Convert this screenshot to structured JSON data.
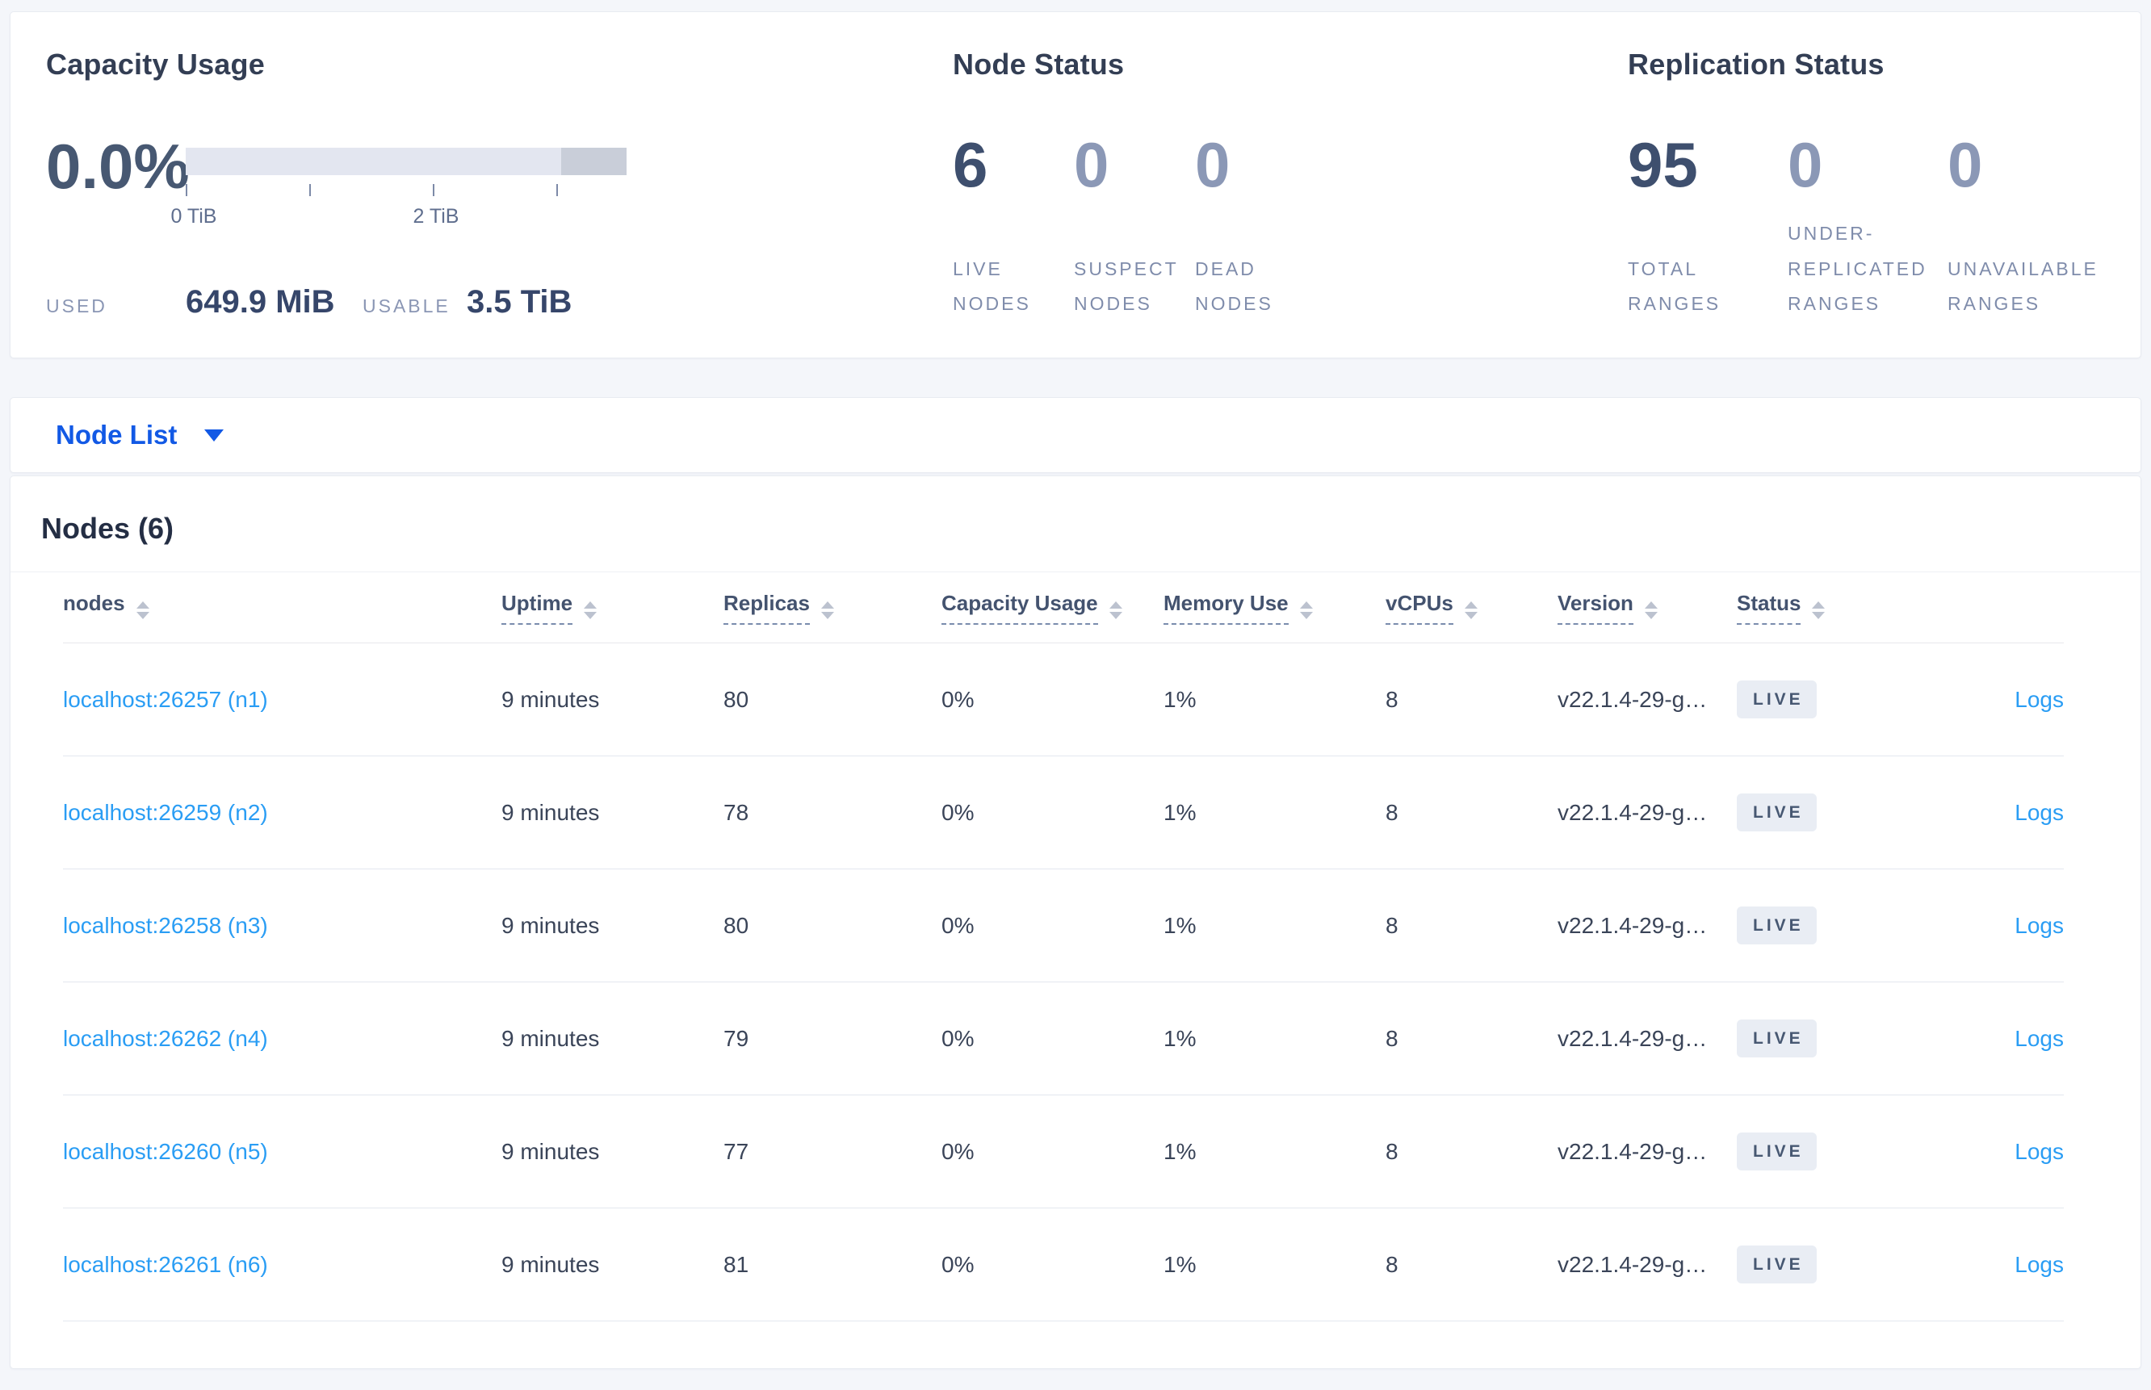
{
  "colors": {
    "link_blue": "#2a9df4",
    "primary_blue": "#1259e5",
    "badge_bg": "#e9edf4",
    "badge_text": "#475872",
    "bar_track": "#e3e6f0",
    "bar_dark_segment": "#c9ced9"
  },
  "summary": {
    "capacity": {
      "title": "Capacity Usage",
      "used_percent": "0.0%",
      "axis_labels": [
        "0 TiB",
        "2 TiB"
      ],
      "used_label": "USED",
      "used_value": "649.9 MiB",
      "usable_label": "USABLE",
      "usable_value": "3.5 TiB"
    },
    "node_status": {
      "title": "Node Status",
      "stats": [
        {
          "value": "6",
          "label": "LIVE NODES"
        },
        {
          "value": "0",
          "label": "SUSPECT NODES"
        },
        {
          "value": "0",
          "label": "DEAD NODES"
        }
      ]
    },
    "replication_status": {
      "title": "Replication Status",
      "stats": [
        {
          "value": "95",
          "label": "TOTAL RANGES"
        },
        {
          "value": "0",
          "label": "UNDER-REPLICATED RANGES"
        },
        {
          "value": "0",
          "label": "UNAVAILABLE RANGES"
        }
      ]
    }
  },
  "node_list": {
    "label": "Node List"
  },
  "nodes_section": {
    "title": "Nodes (6)",
    "columns": [
      {
        "label": "nodes"
      },
      {
        "label": "Uptime"
      },
      {
        "label": "Replicas"
      },
      {
        "label": "Capacity Usage"
      },
      {
        "label": "Memory Use"
      },
      {
        "label": "vCPUs"
      },
      {
        "label": "Version"
      },
      {
        "label": "Status"
      }
    ],
    "rows": [
      {
        "address": "localhost:26257 (n1)",
        "uptime": "9 minutes",
        "replicas": "80",
        "capacity_usage": "0%",
        "memory_use": "1%",
        "vcpus": "8",
        "version": "v22.1.4-29-g…",
        "status": "LIVE",
        "logs": "Logs"
      },
      {
        "address": "localhost:26259 (n2)",
        "uptime": "9 minutes",
        "replicas": "78",
        "capacity_usage": "0%",
        "memory_use": "1%",
        "vcpus": "8",
        "version": "v22.1.4-29-g…",
        "status": "LIVE",
        "logs": "Logs"
      },
      {
        "address": "localhost:26258 (n3)",
        "uptime": "9 minutes",
        "replicas": "80",
        "capacity_usage": "0%",
        "memory_use": "1%",
        "vcpus": "8",
        "version": "v22.1.4-29-g…",
        "status": "LIVE",
        "logs": "Logs"
      },
      {
        "address": "localhost:26262 (n4)",
        "uptime": "9 minutes",
        "replicas": "79",
        "capacity_usage": "0%",
        "memory_use": "1%",
        "vcpus": "8",
        "version": "v22.1.4-29-g…",
        "status": "LIVE",
        "logs": "Logs"
      },
      {
        "address": "localhost:26260 (n5)",
        "uptime": "9 minutes",
        "replicas": "77",
        "capacity_usage": "0%",
        "memory_use": "1%",
        "vcpus": "8",
        "version": "v22.1.4-29-g…",
        "status": "LIVE",
        "logs": "Logs"
      },
      {
        "address": "localhost:26261 (n6)",
        "uptime": "9 minutes",
        "replicas": "81",
        "capacity_usage": "0%",
        "memory_use": "1%",
        "vcpus": "8",
        "version": "v22.1.4-29-g…",
        "status": "LIVE",
        "logs": "Logs"
      }
    ]
  }
}
